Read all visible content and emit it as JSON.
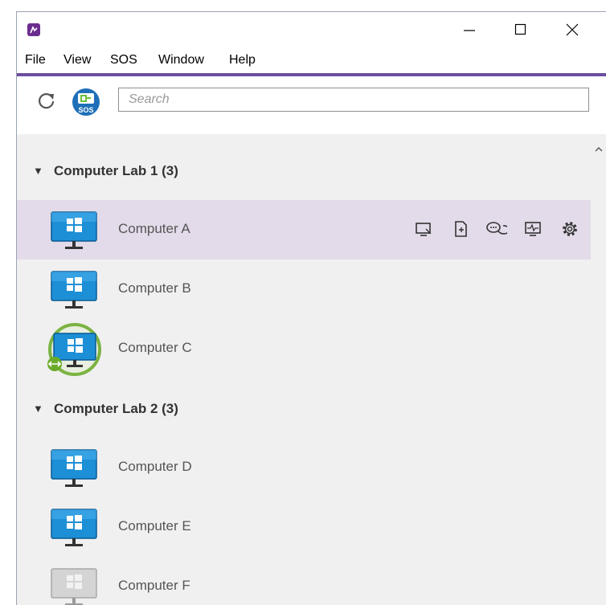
{
  "window": {
    "controls": {
      "minimize": "minimize-icon",
      "maximize": "maximize-icon",
      "close": "close-icon"
    }
  },
  "menu": {
    "items": [
      {
        "label": "File"
      },
      {
        "label": "View"
      },
      {
        "label": "SOS"
      },
      {
        "label": "Window"
      },
      {
        "label": "Help"
      }
    ]
  },
  "toolbar": {
    "refresh_icon": "refresh-icon",
    "sos_icon": "sos-icon",
    "sos_label": "SOS",
    "search_placeholder": "Search"
  },
  "groups": [
    {
      "title": "Computer Lab 1 (3)",
      "computers": [
        {
          "name": "Computer A",
          "status": "online",
          "selected": true
        },
        {
          "name": "Computer B",
          "status": "online"
        },
        {
          "name": "Computer C",
          "status": "connected"
        }
      ]
    },
    {
      "title": "Computer Lab 2 (3)",
      "computers": [
        {
          "name": "Computer D",
          "status": "online"
        },
        {
          "name": "Computer E",
          "status": "online"
        },
        {
          "name": "Computer F",
          "status": "offline"
        }
      ]
    }
  ],
  "row_actions": [
    "remote-control-icon",
    "file-transfer-icon",
    "chat-icon",
    "monitor-activity-icon",
    "settings-icon"
  ],
  "colors": {
    "accent": "#6b4fa0",
    "selected_row": "#e3dbe9",
    "monitor_blue": "#1d8fd6",
    "connected_ring": "#7cb342",
    "offline_gray": "#c8c8c8"
  }
}
